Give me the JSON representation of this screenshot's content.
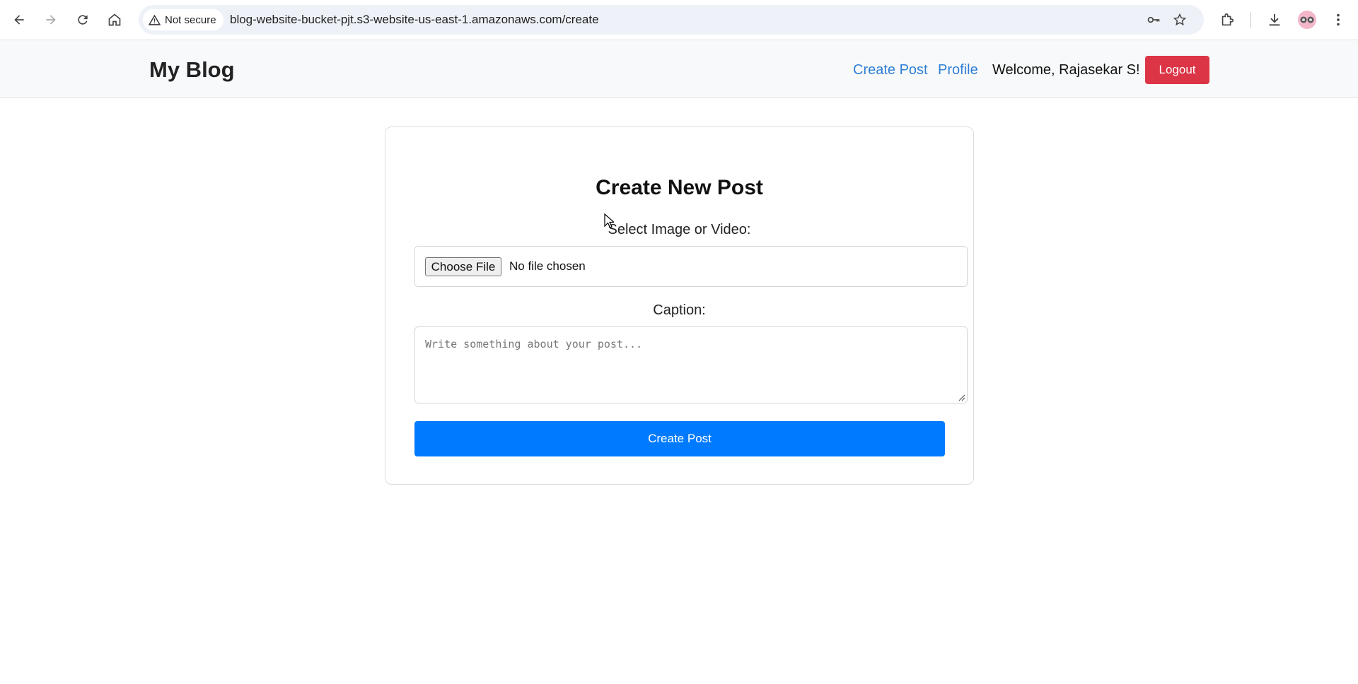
{
  "browser": {
    "security_label": "Not secure",
    "url": "blog-website-bucket-pjt.s3-website-us-east-1.amazonaws.com/create",
    "icons": [
      "back-icon",
      "forward-icon",
      "reload-icon",
      "home-icon",
      "warning-icon",
      "key-icon",
      "star-icon",
      "extensions-icon",
      "download-icon",
      "avatar-icon",
      "kebab-menu-icon"
    ]
  },
  "navbar": {
    "brand": "My Blog",
    "links": [
      "Create Post",
      "Profile"
    ],
    "welcome": "Welcome, Rajasekar S!",
    "logout_label": "Logout"
  },
  "form": {
    "title": "Create New Post",
    "media_label": "Select Image or Video:",
    "choose_file_label": "Choose File",
    "file_status": "No file chosen",
    "caption_label": "Caption:",
    "caption_placeholder": "Write something about your post...",
    "caption_value": "",
    "submit_label": "Create Post"
  },
  "colors": {
    "link": "#2f7fd6",
    "logout": "#dc3545",
    "primary": "#007bff",
    "navbar_bg": "#f8f9fa"
  }
}
